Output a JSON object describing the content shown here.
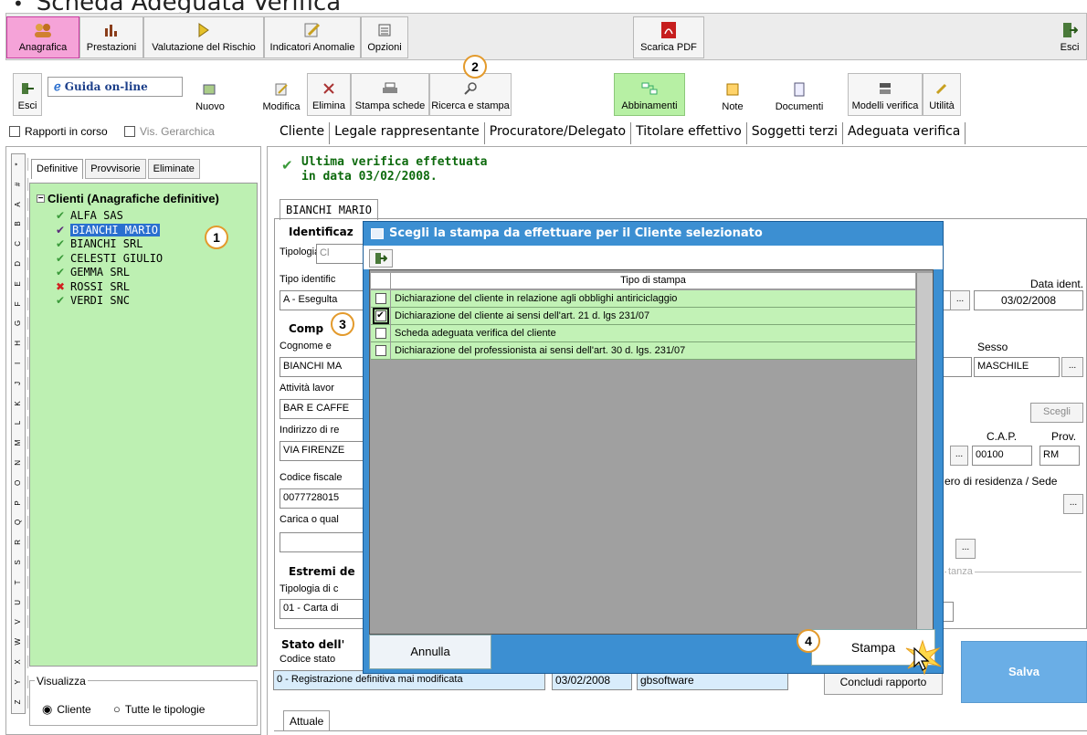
{
  "page_title": "Scheda Adeguata Verifica",
  "top_tabs": [
    {
      "label": "Anagrafica",
      "icon": "people-icon"
    },
    {
      "label": "Prestazioni",
      "icon": "bar-chart-icon"
    },
    {
      "label": "Valutazione del Rischio",
      "icon": "arrow-icon"
    },
    {
      "label": "Indicatori Anomalie",
      "icon": "pencil-icon"
    },
    {
      "label": "Opzioni",
      "icon": "settings-icon"
    },
    {
      "label": "Scarica PDF",
      "icon": "pdf-icon"
    },
    {
      "label": "Esci",
      "icon": "exit-icon"
    }
  ],
  "toolbar": {
    "esci": "Esci",
    "guida": "Guida on-line",
    "nuovo": "Nuovo",
    "modifica": "Modifica",
    "elimina": "Elimina",
    "stampa_schede": "Stampa schede",
    "ricerca": "Ricerca e stampa",
    "abbinamenti": "Abbinamenti",
    "note": "Note",
    "documenti": "Documenti",
    "modelli": "Modelli verifica",
    "utilita": "Utilità"
  },
  "filters": {
    "rapporti": "Rapporti in corso",
    "vis_gerarchica": "Vis. Gerarchica"
  },
  "left_tabs": [
    "Definitive",
    "Provvisorie",
    "Eliminate"
  ],
  "alphabet": [
    "*",
    "#",
    "A",
    "B",
    "C",
    "D",
    "E",
    "F",
    "G",
    "H",
    "I",
    "J",
    "K",
    "L",
    "M",
    "N",
    "O",
    "P",
    "Q",
    "R",
    "S",
    "T",
    "U",
    "V",
    "W",
    "X",
    "Y",
    "Z"
  ],
  "tree": {
    "root": "Clienti (Anagrafiche definitive)",
    "items": [
      {
        "label": "ALFA SAS",
        "status": "ok"
      },
      {
        "label": "BIANCHI MARIO",
        "status": "selected"
      },
      {
        "label": "BIANCHI SRL",
        "status": "ok"
      },
      {
        "label": "CELESTI GIULIO",
        "status": "ok"
      },
      {
        "label": "GEMMA SRL",
        "status": "ok"
      },
      {
        "label": "ROSSI SRL",
        "status": "error"
      },
      {
        "label": "VERDI SNC",
        "status": "ok"
      }
    ]
  },
  "visualizza": {
    "label": "Visualizza",
    "opt1": "Cliente",
    "opt2": "Tutte le tipologie"
  },
  "main_tabs": [
    "Cliente",
    "Legale rappresentante",
    "Procuratore/Delegato",
    "Titolare effettivo",
    "Soggetti terzi",
    "Adeguata verifica"
  ],
  "verification": {
    "line1": "Ultima verifica effettuata",
    "line2": "in data 03/02/2008."
  },
  "client_tab": "BIANCHI MARIO",
  "form": {
    "identificazione": "Identificaz",
    "tipologia_label": "Tipologia",
    "tipologia_value": "Cl",
    "tipo_ident_label": "Tipo identific",
    "tipo_ident_value": "A - Esegulta",
    "data_ident_label": "Data ident.",
    "data_ident_value": "03/02/2008",
    "comp_label": "Comp",
    "cognome_label": "Cognome e",
    "cognome_value": "BIANCHI MA",
    "sesso_label": "Sesso",
    "sesso_value": "MASCHILE",
    "attivita_label": "Attività lavor",
    "attivita_value": "BAR E CAFFE",
    "scegli": "Scegli",
    "indirizzo_label": "Indirizzo di re",
    "indirizzo_value": "VIA FIRENZE",
    "cap_label": "C.A.P.",
    "cap_value": "00100",
    "prov_label": "Prov.",
    "prov_value": "RM",
    "cf_label": "Codice fiscale",
    "cf_value": "0077728015",
    "estero_label": "ero di residenza / Sede",
    "carica_label": "Carica o qual",
    "estremi_label": "Estremi de",
    "tipologia2_label": "Tipologia di c",
    "tipologia2_value": "01 - Carta di",
    "istanza_label": "tanza",
    "ellipsis": "..."
  },
  "status": {
    "label": "Stato dell'",
    "codice_label": "Codice stato",
    "value": "0 - Registrazione definitiva mai modificata",
    "date": "03/02/2008",
    "user": "gbsoftware",
    "concludi": "Concludi rapporto",
    "salva": "Salva",
    "attuale": "Attuale"
  },
  "dialog": {
    "title": "Scegli la stampa da effettuare per il Cliente selezionato",
    "column_header": "Tipo di stampa",
    "rows": [
      {
        "label": "Dichiarazione del cliente in relazione agli obblighi antiriciclaggio",
        "checked": false
      },
      {
        "label": "Dichiarazione del cliente ai sensi dell'art. 21 d. lgs 231/07",
        "checked": true
      },
      {
        "label": "Scheda adeguata verifica del cliente",
        "checked": false
      },
      {
        "label": "Dichiarazione del professionista ai sensi dell'art. 30 d. lgs. 231/07",
        "checked": false
      }
    ],
    "annulla": "Annulla",
    "stampa": "Stampa"
  },
  "callouts": [
    "1",
    "2",
    "3",
    "4"
  ],
  "colors": {
    "accent_pink": "#f5a3d8",
    "dialog_blue": "#3c8fd2",
    "row_green": "#c2f2b6",
    "callout_orange": "#e39a2c",
    "input_blue": "#d8ecfb"
  }
}
